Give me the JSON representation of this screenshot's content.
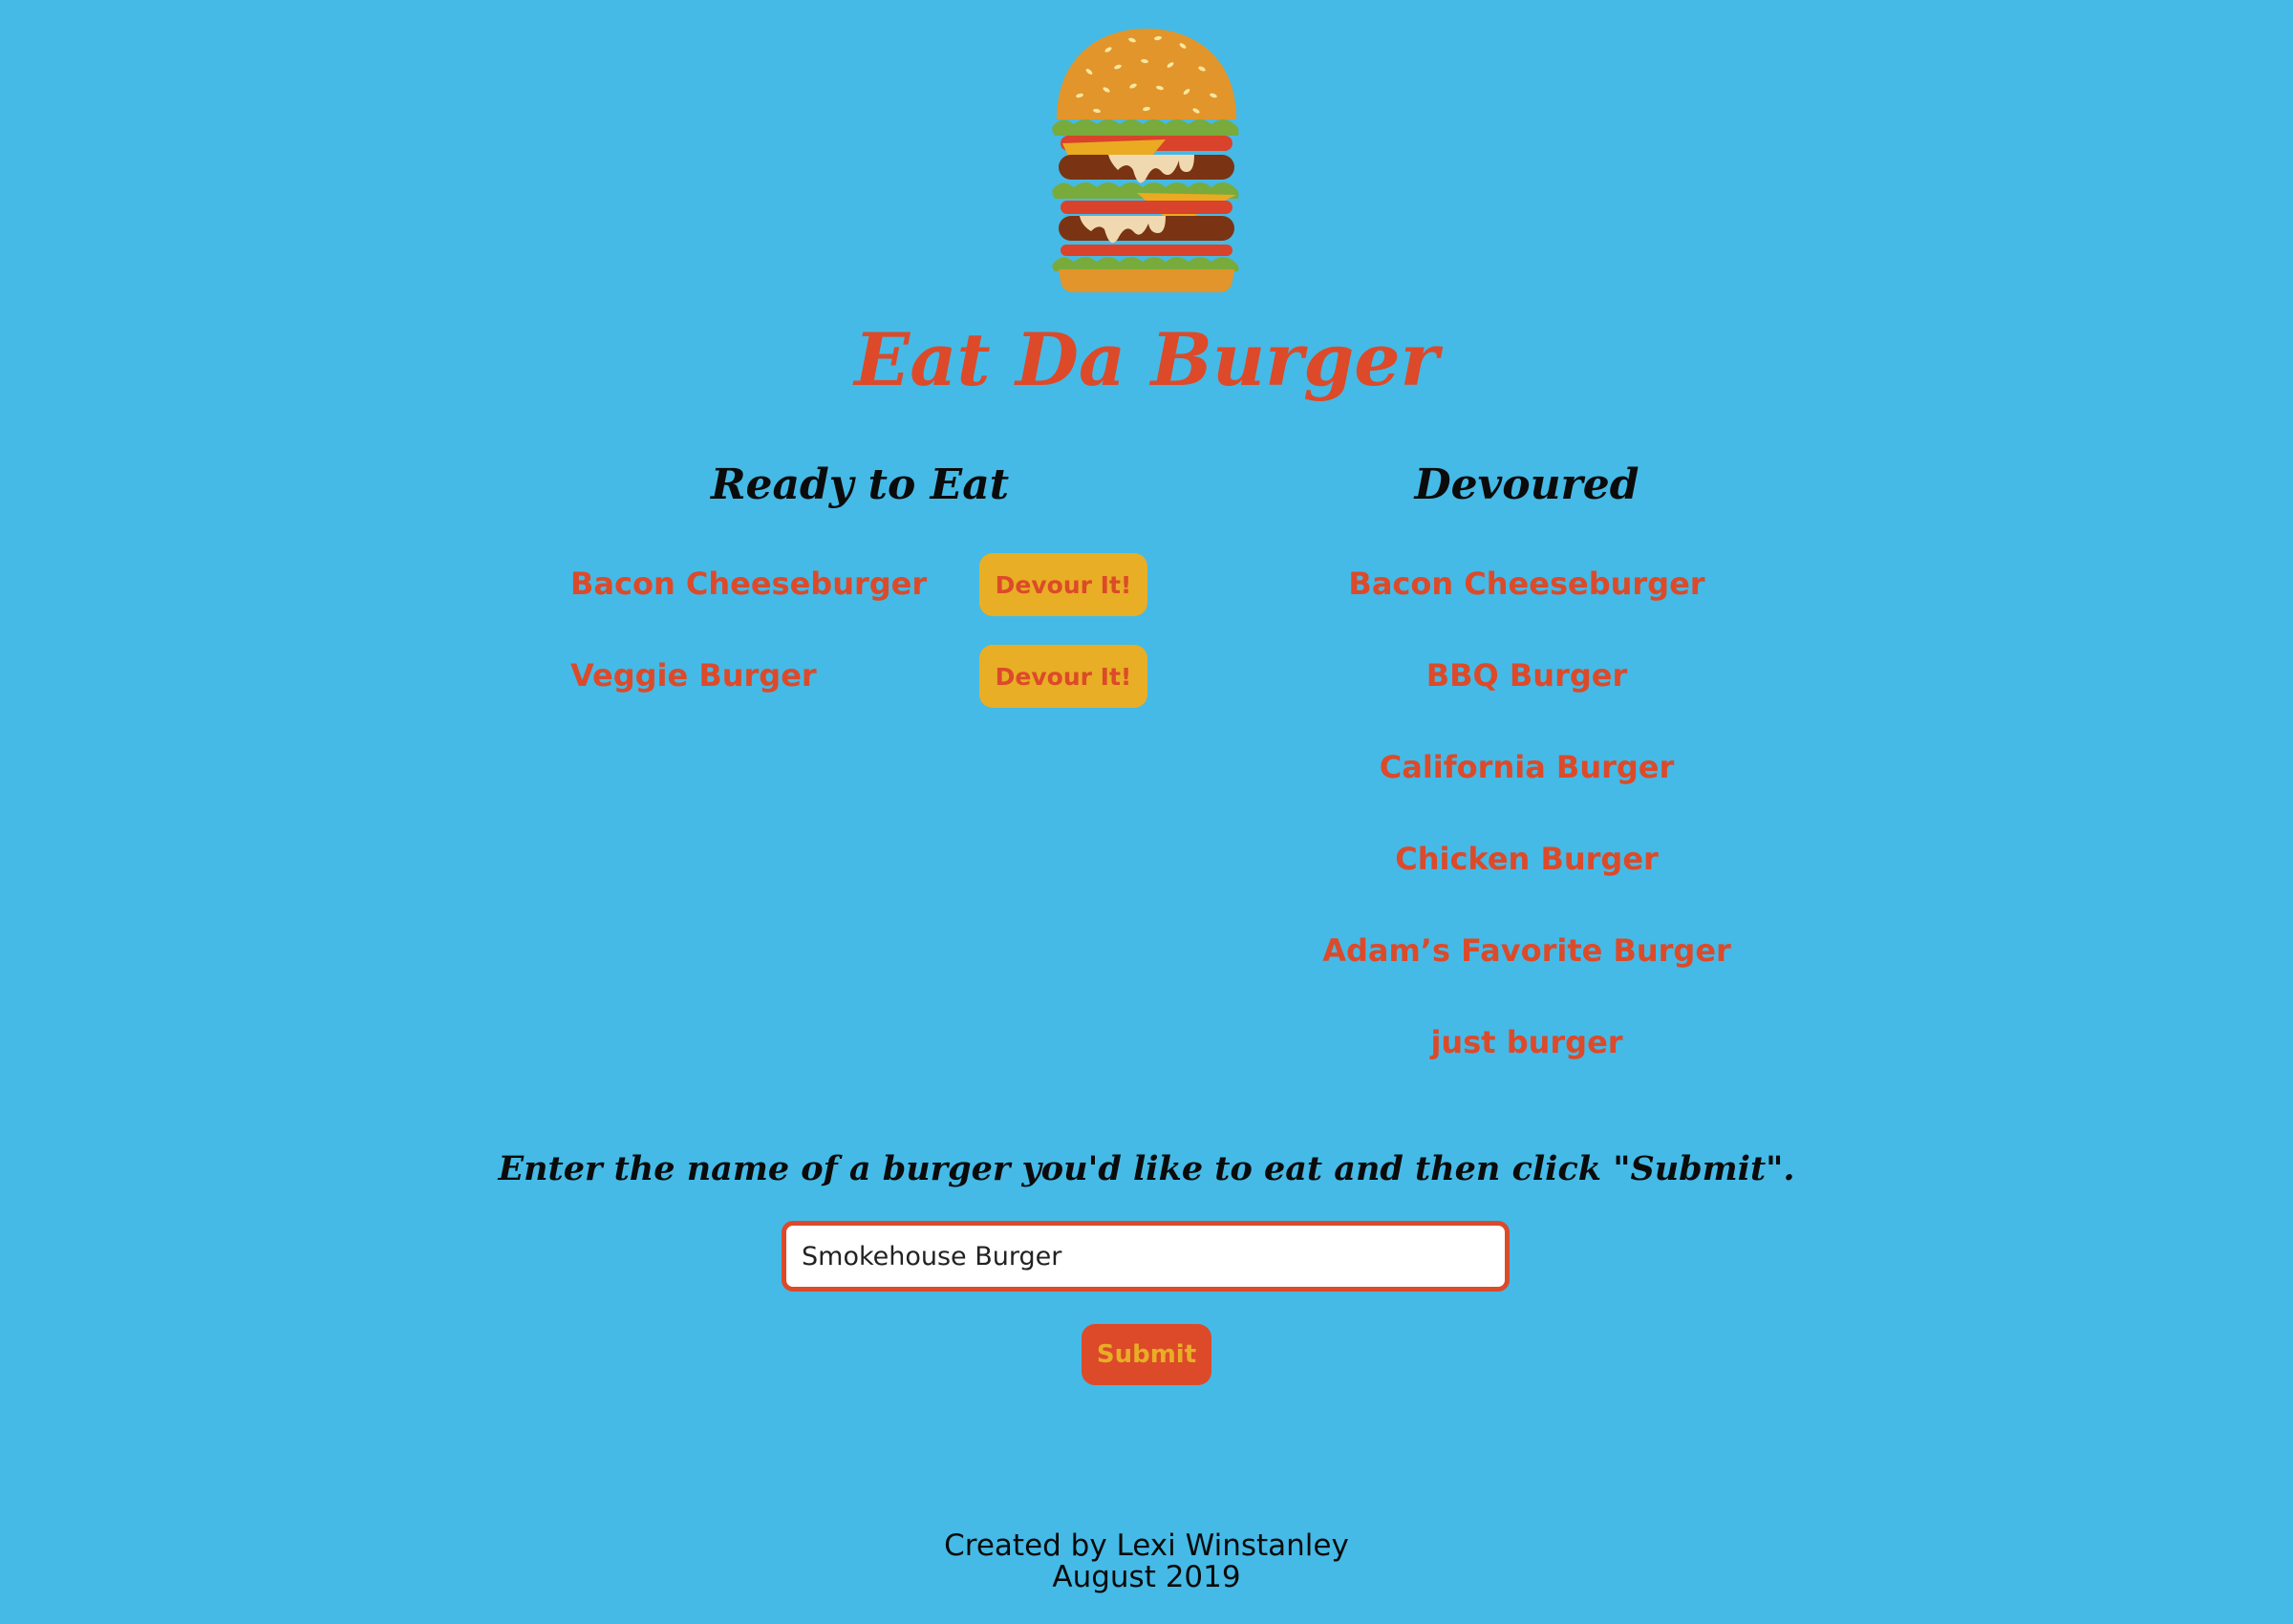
{
  "header": {
    "logo_icon": "burger-icon",
    "title": "Eat Da Burger"
  },
  "ready": {
    "heading": "Ready to Eat",
    "items": [
      {
        "name": "Bacon Cheeseburger",
        "button_label": "Devour It!"
      },
      {
        "name": "Veggie Burger",
        "button_label": "Devour It!"
      }
    ]
  },
  "devoured": {
    "heading": "Devoured",
    "items": [
      "Bacon Cheeseburger",
      "BBQ Burger",
      "California Burger",
      "Chicken Burger",
      "Adam’s Favorite Burger",
      "just burger"
    ]
  },
  "form": {
    "prompt": "Enter the name of a burger you'd like to eat and then click \"Submit\".",
    "input_value": "Smokehouse Burger",
    "submit_label": "Submit"
  },
  "footer": {
    "credit": "Created by Lexi Winstanley",
    "date": "August 2019"
  },
  "colors": {
    "background": "#45bae6",
    "accent_red": "#dc4a2a",
    "accent_yellow": "#e8ae25",
    "text_dark": "#0b0b0b"
  }
}
